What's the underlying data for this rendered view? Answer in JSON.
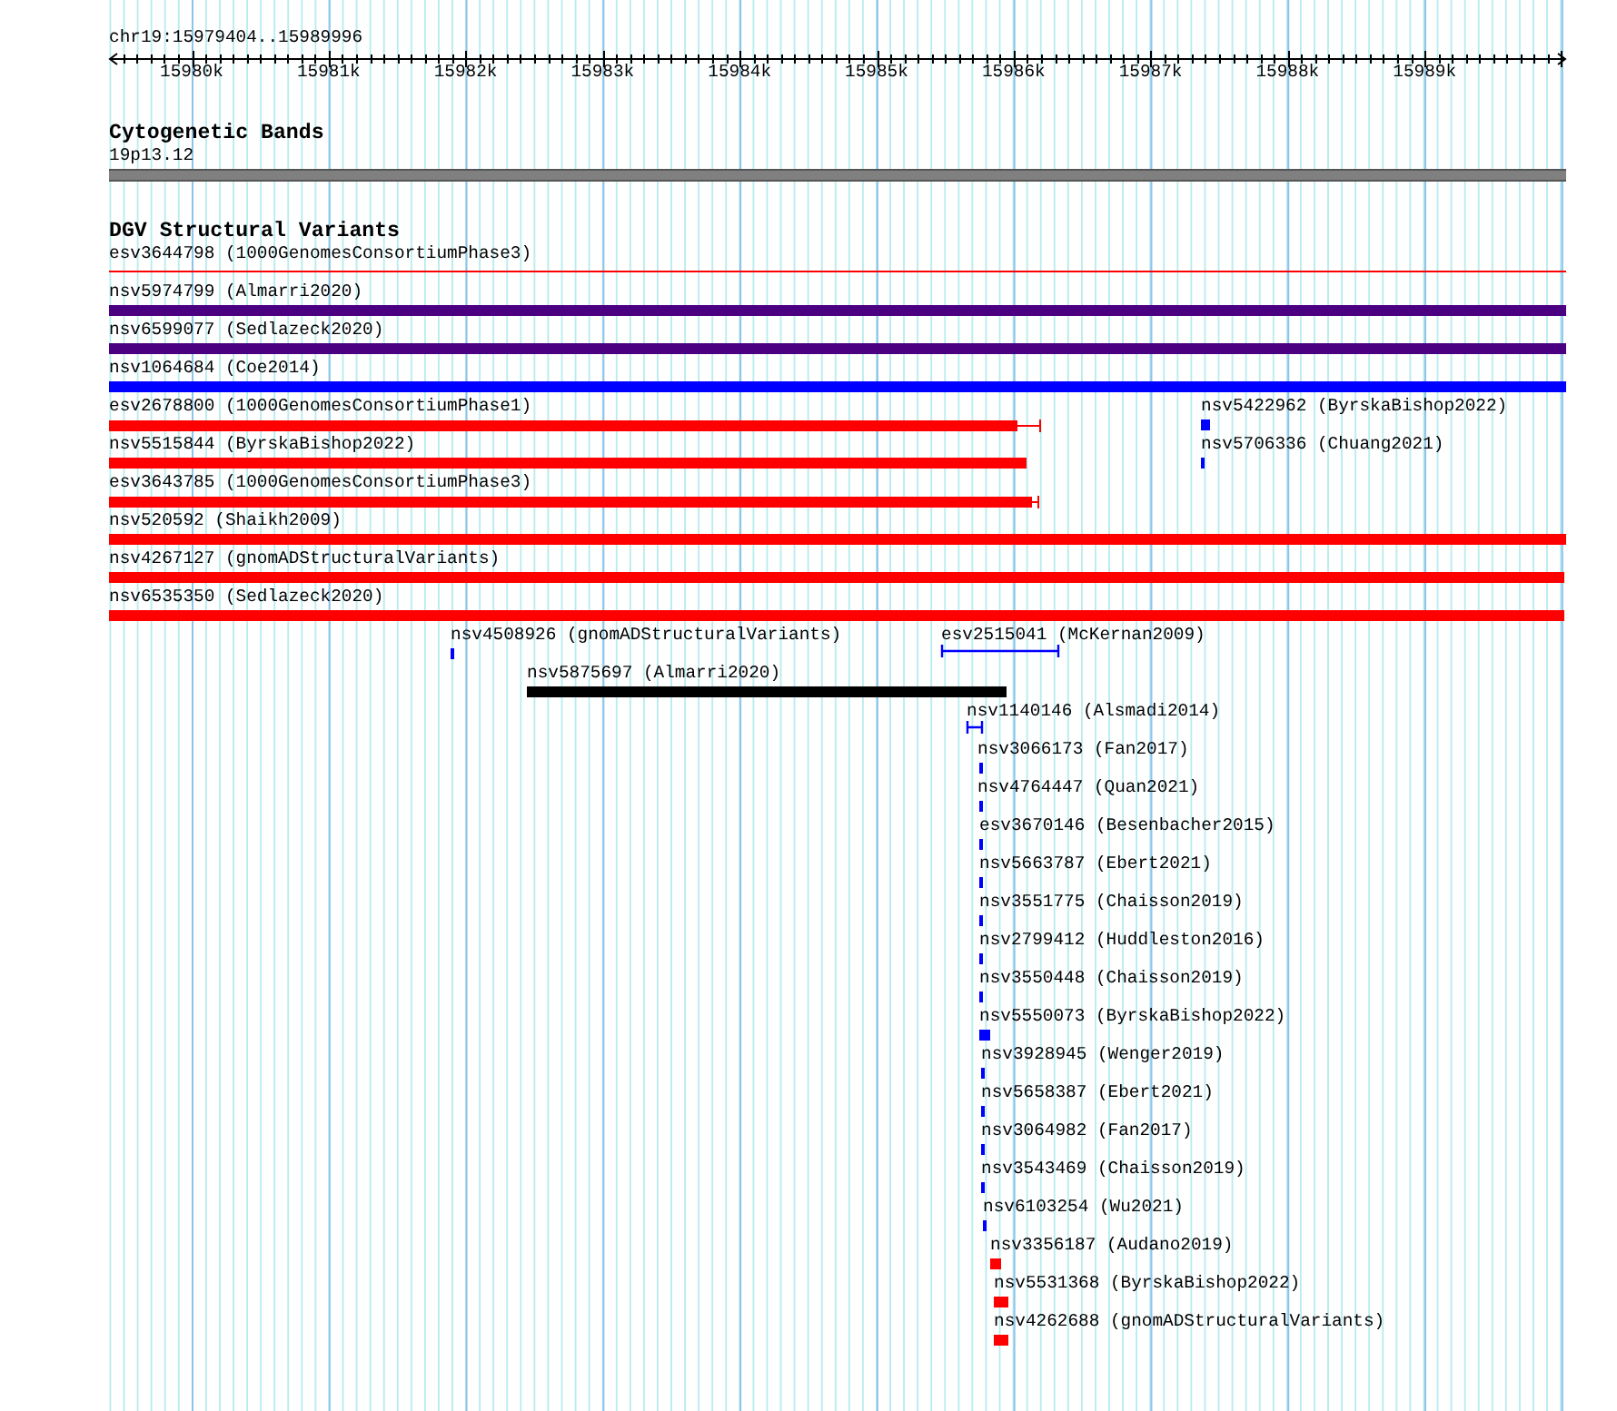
{
  "ruler": {
    "location": "chr19:15979404..15989996",
    "ticks": [
      "15980k",
      "15981k",
      "15982k",
      "15983k",
      "15984k",
      "15985k",
      "15986k",
      "15987k",
      "15988k",
      "15989k"
    ]
  },
  "cytobands": {
    "title": "Cytogenetic Bands",
    "band": "19p13.12"
  },
  "variants": {
    "title": "DGV Structural Variants",
    "features": [
      {
        "label": "esv3644798 (1000GenomesConsortiumPhase3)",
        "color": "#ff0000",
        "kind": "line"
      },
      {
        "label": "nsv5974799 (Almarri2020)",
        "color": "#4b0082",
        "kind": "bar"
      },
      {
        "label": "nsv6599077 (Sedlazeck2020)",
        "color": "#4b0082",
        "kind": "bar"
      },
      {
        "label": "nsv1064684 (Coe2014)",
        "color": "#0000ff",
        "kind": "bar"
      },
      {
        "label": "esv2678800 (1000GenomesConsortiumPhase1)",
        "color": "#ff0000",
        "kind": "bar-tail"
      },
      {
        "label": "nsv5422962 (ByrskaBishop2022)",
        "color": "#0000ff",
        "kind": "bar"
      },
      {
        "label": "nsv5515844 (ByrskaBishop2022)",
        "color": "#ff0000",
        "kind": "bar"
      },
      {
        "label": "nsv5706336 (Chuang2021)",
        "color": "#0000ff",
        "kind": "bar"
      },
      {
        "label": "esv3643785 (1000GenomesConsortiumPhase3)",
        "color": "#ff0000",
        "kind": "bar-tail"
      },
      {
        "label": "nsv520592 (Shaikh2009)",
        "color": "#ff0000",
        "kind": "bar"
      },
      {
        "label": "nsv4267127 (gnomADStructuralVariants)",
        "color": "#ff0000",
        "kind": "bar"
      },
      {
        "label": "nsv6535350 (Sedlazeck2020)",
        "color": "#ff0000",
        "kind": "bar"
      },
      {
        "label": "nsv4508926 (gnomADStructuralVariants)",
        "color": "#0000ff",
        "kind": "bar"
      },
      {
        "label": "esv2515041 (McKernan2009)",
        "color": "#0000ff",
        "kind": "span"
      },
      {
        "label": "nsv5875697 (Almarri2020)",
        "color": "#000000",
        "kind": "bar"
      },
      {
        "label": "nsv1140146 (Alsmadi2014)",
        "color": "#0000ff",
        "kind": "span"
      },
      {
        "label": "nsv3066173 (Fan2017)",
        "color": "#0000ff",
        "kind": "bar"
      },
      {
        "label": "nsv4764447 (Quan2021)",
        "color": "#0000ff",
        "kind": "bar"
      },
      {
        "label": "esv3670146 (Besenbacher2015)",
        "color": "#0000ff",
        "kind": "bar"
      },
      {
        "label": "nsv5663787 (Ebert2021)",
        "color": "#0000ff",
        "kind": "bar"
      },
      {
        "label": "nsv3551775 (Chaisson2019)",
        "color": "#0000ff",
        "kind": "bar"
      },
      {
        "label": "nsv2799412 (Huddleston2016)",
        "color": "#0000ff",
        "kind": "bar"
      },
      {
        "label": "nsv3550448 (Chaisson2019)",
        "color": "#0000ff",
        "kind": "bar"
      },
      {
        "label": "nsv5550073 (ByrskaBishop2022)",
        "color": "#0000ff",
        "kind": "bar"
      },
      {
        "label": "nsv3928945 (Wenger2019)",
        "color": "#0000ff",
        "kind": "bar"
      },
      {
        "label": "nsv5658387 (Ebert2021)",
        "color": "#0000ff",
        "kind": "bar"
      },
      {
        "label": "nsv3064982 (Fan2017)",
        "color": "#0000ff",
        "kind": "bar"
      },
      {
        "label": "nsv3543469 (Chaisson2019)",
        "color": "#0000ff",
        "kind": "bar"
      },
      {
        "label": "nsv6103254 (Wu2021)",
        "color": "#0000ff",
        "kind": "bar"
      },
      {
        "label": "nsv3356187 (Audano2019)",
        "color": "#ff0000",
        "kind": "bar"
      },
      {
        "label": "nsv5531368 (ByrskaBishop2022)",
        "color": "#ff0000",
        "kind": "bar"
      },
      {
        "label": "nsv4262688 (gnomADStructuralVariants)",
        "color": "#ff0000",
        "kind": "bar"
      }
    ]
  }
}
